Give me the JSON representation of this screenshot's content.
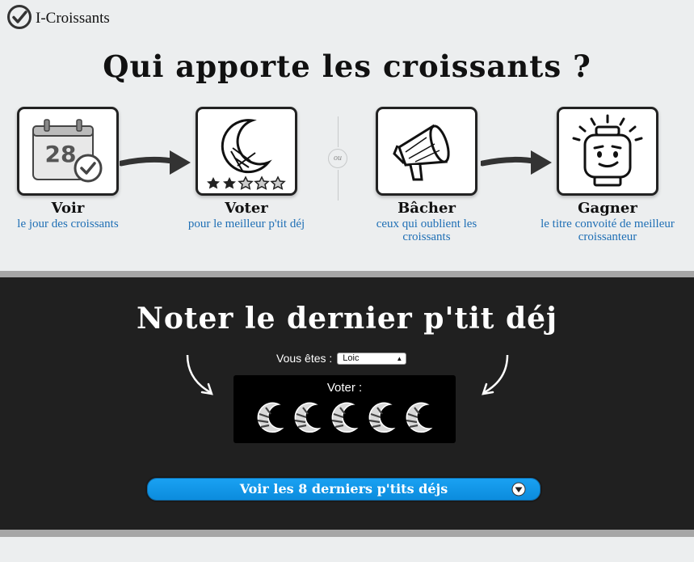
{
  "app": {
    "name": "I-Croissants"
  },
  "header": {
    "title": "Qui apporte les croissants ?"
  },
  "steps": [
    {
      "title": "Voir",
      "subtitle": "le jour des croissants",
      "icon": "calendar-check-icon",
      "calendar_day": "28"
    },
    {
      "title": "Voter",
      "subtitle": "pour le meilleur p'tit déj",
      "icon": "moon-stars-icon",
      "rating": 2,
      "rating_max": 5
    },
    {
      "title": "Bâcher",
      "subtitle": "ceux qui oublient les croissants",
      "icon": "megaphone-icon"
    },
    {
      "title": "Gagner",
      "subtitle": "le titre convoité de meilleur croissanteur",
      "icon": "lego-head-icon"
    }
  ],
  "separator": {
    "label": "ou"
  },
  "vote": {
    "title": "Noter le dernier p'tit déj",
    "you_are_label": "Vous êtes :",
    "selected_user": "Loic",
    "vote_label": "Voter :",
    "croissant_count": 5
  },
  "history": {
    "button_label": "Voir les 8 derniers p'tits déjs"
  },
  "colors": {
    "accent": "#1f6fb5",
    "button": "#1aa2f3",
    "dark_bg": "#202020"
  }
}
